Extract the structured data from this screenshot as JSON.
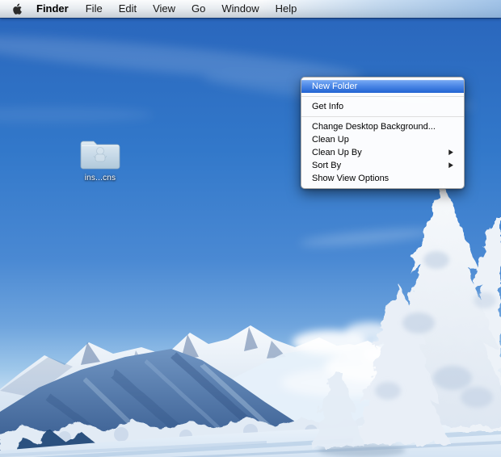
{
  "menubar": {
    "items": [
      {
        "label": "Finder",
        "bold": true
      },
      {
        "label": "File"
      },
      {
        "label": "Edit"
      },
      {
        "label": "View"
      },
      {
        "label": "Go"
      },
      {
        "label": "Window"
      },
      {
        "label": "Help"
      }
    ]
  },
  "desktop": {
    "wallpaper_description": "winter-mountain-snow-scene",
    "icons": [
      {
        "type": "folder",
        "label": "ins...cns"
      }
    ]
  },
  "context_menu": {
    "submenu_arrow": "▶",
    "items": [
      {
        "label": "New Folder",
        "highlighted": true
      },
      {
        "type": "separator"
      },
      {
        "label": "Get Info"
      },
      {
        "type": "separator"
      },
      {
        "label": "Change Desktop Background..."
      },
      {
        "label": "Clean Up"
      },
      {
        "label": "Clean Up By",
        "has_submenu": true
      },
      {
        "label": "Sort By",
        "has_submenu": true
      },
      {
        "label": "Show View Options"
      }
    ]
  },
  "colors": {
    "menu_highlight_top": "#74a7f3",
    "menu_highlight_bottom": "#2264d2",
    "menu_background": "#ffffff",
    "menubar_text": "#161616",
    "sky_top": "#2a67bd",
    "sky_horizon": "#e6f0f8",
    "icon_label": "#ffffff"
  }
}
